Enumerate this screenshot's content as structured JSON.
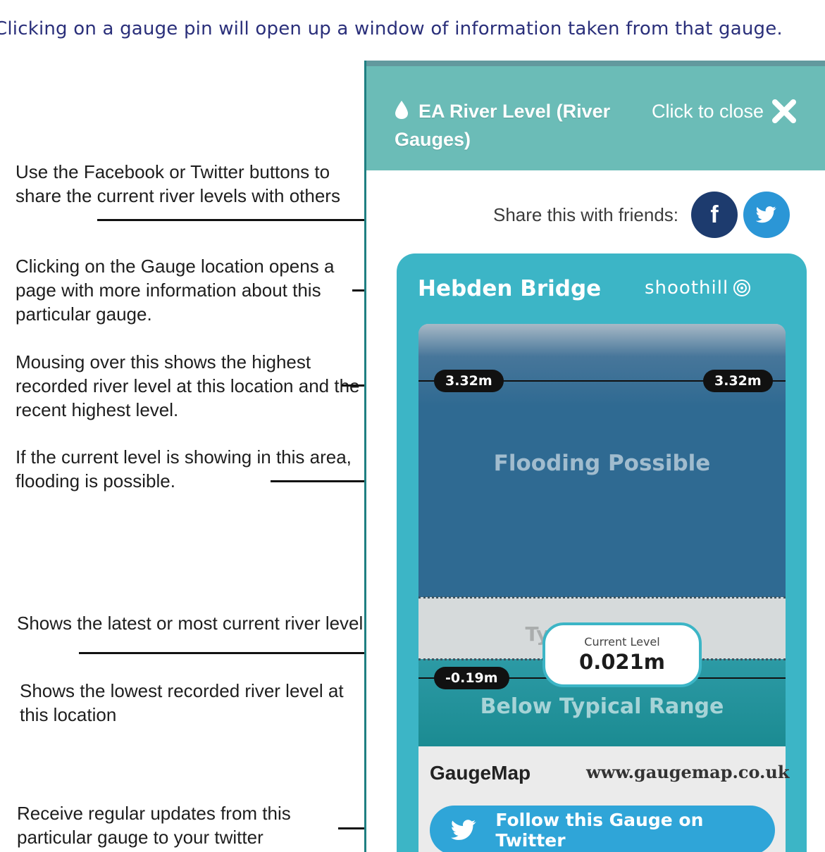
{
  "caption": "Clicking on a gauge pin will open up a window of information taken from that gauge.",
  "notes": {
    "share": "Use the Facebook or Twitter buttons to share the current river levels with others",
    "location": "Clicking on the Gauge location opens a page with more information about this particular gauge.",
    "highest": "Mousing over this shows the highest recorded river level at this location and the recent highest level.",
    "flood_area": "If the current level is showing in this area, flooding is possible.",
    "current": "Shows the latest or most current river level.",
    "lowest": "Shows the lowest recorded river level at this location",
    "updates": "Receive regular updates from this particular gauge to your twitter"
  },
  "popup": {
    "title": "EA River Level (River Gauges)",
    "close_label": "Click to close",
    "share_label": "Share this with friends:",
    "facebook_label": "f",
    "location": "Hebden Bridge",
    "brand": "shoothill",
    "gauge": {
      "highest_left": "3.32m",
      "highest_right": "3.32m",
      "flood_label": "Flooding Possible",
      "typical_label": "Typical Range",
      "below_label": "Below Typical Range",
      "lowest": "-0.19m",
      "current_label": "Current Level",
      "current_value": "0.021m"
    },
    "footer": {
      "name": "GaugeMap",
      "url": "www.gaugemap.co.uk",
      "follow_label": "Follow this Gauge on Twitter"
    }
  },
  "colors": {
    "header": "#6bbcb7",
    "card": "#3cb5c6",
    "facebook": "#1d3b6e",
    "twitter": "#2b96d6"
  }
}
